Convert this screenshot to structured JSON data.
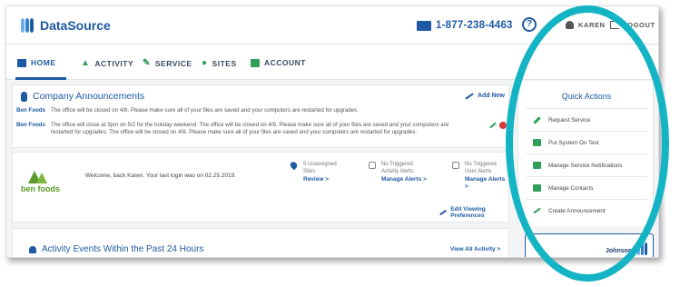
{
  "header": {
    "brand": "DataSource",
    "phone": "1-877-238-4463",
    "help_glyph": "?",
    "user_name": "KAREN",
    "logout_label": "LOGOUT"
  },
  "nav": {
    "items": [
      {
        "label": "HOME",
        "icon": "home-icon",
        "active": true
      },
      {
        "label": "ACTIVITY",
        "icon": "bell-icon",
        "active": false
      },
      {
        "label": "SERVICE",
        "icon": "wrench-icon",
        "active": false
      },
      {
        "label": "SITES",
        "icon": "pin-icon",
        "active": false
      },
      {
        "label": "ACCOUNT",
        "icon": "account-icon",
        "active": false
      }
    ]
  },
  "announcements": {
    "title": "Company Announcements",
    "add_new": "Add New",
    "rows": [
      {
        "company": "Ben Foods",
        "text": "The office will be closed on 4/8.  Please make sure all of your files are saved and your computers are restarted for upgrades."
      },
      {
        "company": "Ben Foods",
        "text": "The office will close at 3pm on 5/2 for the holiday weekend. The office will be closed on 4/8.  Please make sure all of your files are saved and your computers are restarted for upgrades.  The office will be closed on 4/8.  Please make sure all of your files are saved and your computers are restarted for upgrades."
      }
    ]
  },
  "welcome": {
    "company_logo_text": "ben foods",
    "message": "Welcome, back Karen. Your last login was on 02.25.2019.",
    "stats": [
      {
        "line1": "5 Unassigned",
        "line2": "Sites",
        "link": "Review >"
      },
      {
        "line1": "No Triggered",
        "line2": "Activity Alerts",
        "link": "Manage Alerts >"
      },
      {
        "line1": "No Triggered",
        "line2": "User Alerts",
        "link": "Manage Alerts >"
      }
    ],
    "edit_preferences": "Edit Viewing Preferences"
  },
  "activity": {
    "title": "Activity Events Within the Past 24 Hours",
    "view_all": "View All Activity >"
  },
  "quick_actions": {
    "title": "Quick Actions",
    "items": [
      {
        "label": "Request Service",
        "icon": "wrench-icon"
      },
      {
        "label": "Put System On Test",
        "icon": "checkbox-icon"
      },
      {
        "label": "Manage Service Notifications",
        "icon": "message-icon"
      },
      {
        "label": "Manage Contacts",
        "icon": "contacts-icon"
      },
      {
        "label": "Create Announcement",
        "icon": "pencil-icon"
      }
    ]
  },
  "johnson": {
    "label": "Johnson"
  },
  "colors": {
    "brand_blue": "#1e5aa3",
    "accent_green": "#2fa05a",
    "highlight_teal": "#14b4c4",
    "delete_red": "#d9383a"
  }
}
